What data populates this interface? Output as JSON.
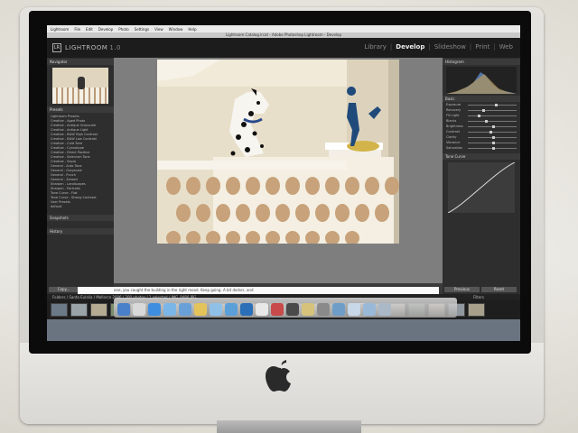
{
  "app": {
    "menubar": [
      "Lightroom",
      "File",
      "Edit",
      "Develop",
      "Photo",
      "Settings",
      "View",
      "Window",
      "Help"
    ],
    "window_title": "Lightroom Catalog.lrcat - Adobe Photoshop Lightroom - Develop",
    "logo_letters": "LR",
    "brand": "LIGHTROOM",
    "version": "1.0"
  },
  "modules": {
    "items": [
      "Library",
      "Develop",
      "Slideshow",
      "Print",
      "Web"
    ],
    "active": "Develop",
    "separator": "|"
  },
  "left_panel": {
    "navigator_label": "Navigator",
    "presets_label": "Presets",
    "presets": [
      "Lightroom Presets",
      "Creative - Aged Photo",
      "Creative - Antique Grayscale",
      "Creative - Antique Light",
      "Creative - B&W High Contrast",
      "Creative - B&W Low Contrast",
      "Creative - Cold Tone",
      "Creative - Cyanotype",
      "Creative - Direct Positive",
      "Creative - Selenium Tone",
      "Creative - Sepia",
      "General - Auto Tone",
      "General - Grayscale",
      "General - Punch",
      "General - Zeroed",
      "Sharpen - Landscapes",
      "Sharpen - Portraits",
      "Tone Curve - Flat",
      "Tone Curve - Strong Contrast",
      "User Presets",
      "default"
    ],
    "snapshots_label": "Snapshots",
    "history_label": "History",
    "copy_button": "Copy...",
    "paste_button": "Paste"
  },
  "right_panel": {
    "histogram_label": "Histogram",
    "basic_label": "Basic",
    "tone_curve_label": "Tone Curve",
    "sliders": [
      {
        "label": "Exposure",
        "value": 0.55
      },
      {
        "label": "Recovery",
        "value": 0.3
      },
      {
        "label": "Fill Light",
        "value": 0.2
      },
      {
        "label": "Blacks",
        "value": 0.35
      },
      {
        "label": "Brightness",
        "value": 0.5
      },
      {
        "label": "Contrast",
        "value": 0.45
      },
      {
        "label": "Clarity",
        "value": 0.5
      },
      {
        "label": "Vibrance",
        "value": 0.5
      },
      {
        "label": "Saturation",
        "value": 0.5
      }
    ],
    "previous_button": "Previous",
    "reset_button": "Reset"
  },
  "toolbar": {
    "text": "Y 667 X 359 X 667"
  },
  "filmstrip": {
    "path": "Folders / Santa Eulalia / Mallorca 2006 / 200 photos / 1 selected / IMG_9486.JPG",
    "filter_label": "Filters",
    "thumb_colors": [
      "#6b7a86",
      "#9aa3a8",
      "#b4ab92",
      "#7d8c6b",
      "#c9c2ae",
      "#8b7f6a",
      "#a1a6ad",
      "#707a80",
      "#bdb6a4",
      "#5e6a76",
      "#b08f6d",
      "#9ca790",
      "#7f8b99",
      "#cdbf9f",
      "#6e7b6a",
      "#a69887",
      "#8e9aa4",
      "#c2b8a2",
      "#74826f",
      "#b7a991",
      "#90979f",
      "#a8a08b"
    ]
  },
  "desktop": {
    "doc_text": "one, you caught the building in the right mood. Keep going. A bit darker, and",
    "dock_colors": [
      "#4a7fc9",
      "#d9d9d9",
      "#3d8ee0",
      "#7ab6e8",
      "#6aa0d8",
      "#e3c35a",
      "#8fc0e8",
      "#5a9fd8",
      "#2a6fb8",
      "#e8e8e8",
      "#c84a4a",
      "#4a4a4a",
      "#d6c27a",
      "#8a8a8a",
      "#6e9ec8",
      "#c8d8e8",
      "#9ab8d8",
      "#aab8c8"
    ]
  },
  "colors": {
    "imac_body": "#e2e1dd",
    "lr_background": "#2e2e2e",
    "photo_wall": "#e8dfca",
    "dog_collar": "#2a4a8a",
    "silhouette": "#1f4a7a"
  }
}
